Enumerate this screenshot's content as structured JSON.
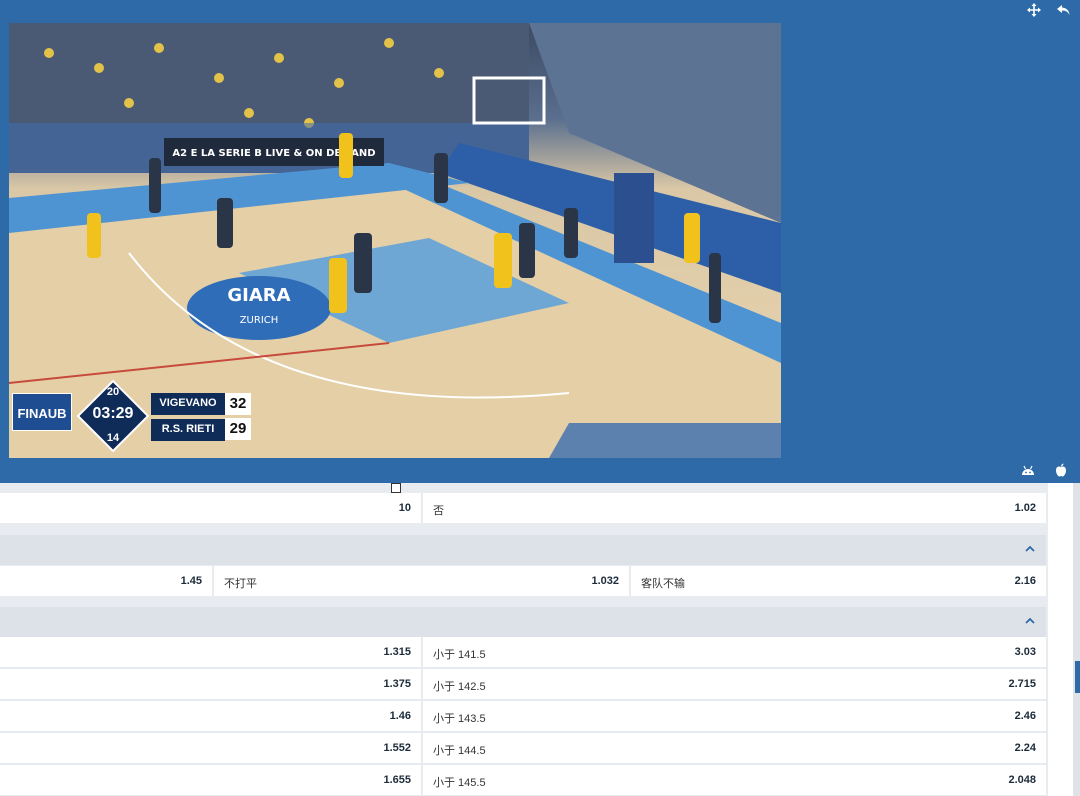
{
  "top_icons": {
    "move": "move-icon",
    "back": "back-arrow-icon",
    "android": "android-icon",
    "apple": "apple-icon"
  },
  "video": {
    "banner_text": "A2 E LA SERIE B LIVE & ON DEMAND",
    "court_logo_text": "GIARA",
    "court_logo_sub": "ZURICH",
    "scoreboard": {
      "logo": "FINAUB",
      "quarter_top": "20",
      "clock": "03:29",
      "quarter_bottom": "14",
      "home_team": "VIGEVANO",
      "home_score": "32",
      "away_team": "R.S. RIETI",
      "away_score": "29"
    }
  },
  "markets": {
    "row_top": {
      "left_odd": "10",
      "right_label": "否",
      "right_odd": "1.02"
    },
    "double_chance": {
      "collapse_icon": "chevron-up-icon",
      "left_odd": "1.45",
      "mid_label": "不打平",
      "mid_odd": "1.032",
      "right_label": "客队不输",
      "right_odd": "2.16"
    },
    "totals": {
      "collapse_icon": "chevron-up-icon",
      "rows": [
        {
          "left_odd": "1.315",
          "right_label": "小于 141.5",
          "right_odd": "3.03"
        },
        {
          "left_odd": "1.375",
          "right_label": "小于 142.5",
          "right_odd": "2.715"
        },
        {
          "left_odd": "1.46",
          "right_label": "小于 143.5",
          "right_odd": "2.46"
        },
        {
          "left_odd": "1.552",
          "right_label": "小于 144.5",
          "right_odd": "2.24"
        },
        {
          "left_odd": "1.655",
          "right_label": "小于 145.5",
          "right_odd": "2.048"
        }
      ]
    }
  }
}
